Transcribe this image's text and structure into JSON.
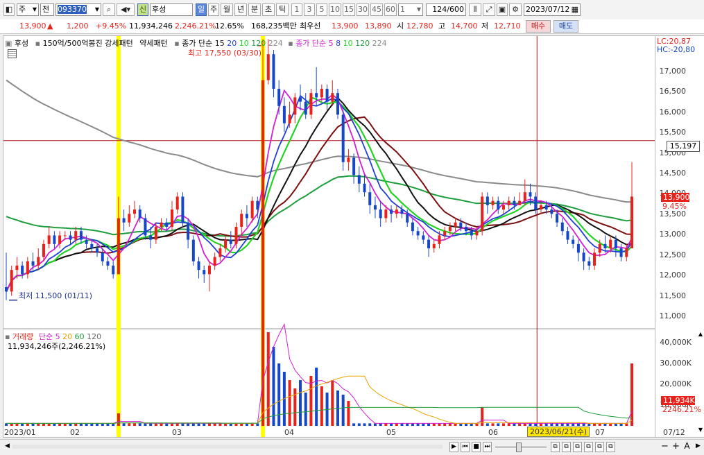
{
  "toolbar": {
    "market": "주",
    "view": "전",
    "code": "093370",
    "new_badge": "신",
    "stock_name": "후성",
    "periods": [
      "일",
      "주",
      "월",
      "년",
      "분",
      "초",
      "틱"
    ],
    "active_period": "일",
    "minutes": [
      "1",
      "3",
      "5",
      "10",
      "15",
      "30",
      "45",
      "60"
    ],
    "custom_minute": "1",
    "count": "124",
    "count_total": "/600",
    "date": "2023/07/12"
  },
  "quote": {
    "price": "13,900",
    "change_arrow": "▲",
    "change": "1,200",
    "change_pct": "+9.45%",
    "volume": "11,934,246",
    "volume_ratio": "2,246.21%",
    "turnover": "12.65%",
    "amount": "168,235백만",
    "best_label": "최우선",
    "best_ask": "13,900",
    "best_bid": "13,890",
    "open_label": "시",
    "open": "12,780",
    "high_label": "고",
    "high": "14,700",
    "low_label": "저",
    "low": "12,710",
    "buy": "매수",
    "sell": "매도"
  },
  "price_legend": {
    "name": "후성",
    "pattern": "150억/500억봉진 강세패턴",
    "weak": "약세패턴",
    "close_ma_label": "종가 단순",
    "ma_set1": [
      "15",
      "20",
      "10",
      "120",
      "224"
    ],
    "close_ma_label2": "종가 단순",
    "ma_set2": [
      "5",
      "8",
      "10",
      "120",
      "224"
    ],
    "high_note": "최고 17,550 (03/30)",
    "low_note": "최저 11,500 (01/11)"
  },
  "limits": {
    "lc": "LC:20,87",
    "hc": "HC:-20,80"
  },
  "price_axis": [
    "17,000",
    "16,500",
    "16,000",
    "15,500",
    "15,000",
    "14,500",
    "14,000",
    "13,500",
    "13,000",
    "12,500",
    "12,000",
    "11,500",
    "11,000"
  ],
  "cursor_price": "15,197",
  "last_price_tag": "13,900",
  "last_pct_tag": "9.45%",
  "volume_legend": {
    "label": "거래량",
    "ma_label": "단순",
    "periods": [
      "5",
      "20",
      "60",
      "120"
    ],
    "value": "11,934,246주(2,246.21%)"
  },
  "volume_axis": [
    "40,000K",
    "30,000K",
    "20,000K",
    "10,000K"
  ],
  "volume_tag": "11,934K",
  "volume_pct_tag": "2246.21%",
  "x_axis": [
    "2023/01",
    "02",
    "03",
    "04",
    "05",
    "06",
    "07"
  ],
  "cursor_date": "2023/06/21(수)",
  "end_date": "07/12",
  "colors": {
    "up": "#e8221b",
    "down": "#1747c9",
    "ma5": "#d21fd2",
    "ma10": "#22d422",
    "ma20": "#1f3fd6",
    "ma15": "#111111",
    "ma60": "#7a1010",
    "ma120": "#1e9e3c",
    "ma224": "#8a8a8a",
    "highlight": "#ffff00"
  },
  "chart_data": {
    "type": "candlestick",
    "x": [
      "2023/01",
      "02",
      "03",
      "04",
      "05",
      "06",
      "07"
    ],
    "ylim": [
      10900,
      17300
    ],
    "candles": [
      [
        0,
        11800,
        11700,
        12600,
        11500
      ],
      [
        1,
        11700,
        12200,
        12300,
        11600
      ],
      [
        2,
        12200,
        12300,
        12500,
        12000
      ],
      [
        3,
        12300,
        12100,
        12400,
        12000
      ],
      [
        4,
        12100,
        12400,
        12500,
        12000
      ],
      [
        5,
        12400,
        12300,
        12600,
        12200
      ],
      [
        6,
        12300,
        12500,
        12700,
        12200
      ],
      [
        7,
        12500,
        12800,
        12900,
        12400
      ],
      [
        8,
        12800,
        13000,
        13200,
        12700
      ],
      [
        9,
        13000,
        12800,
        13100,
        12700
      ],
      [
        10,
        12800,
        13000,
        13100,
        12700
      ],
      [
        11,
        13000,
        13000,
        13100,
        12900
      ],
      [
        12,
        13000,
        12900,
        13100,
        12800
      ],
      [
        13,
        12900,
        13100,
        13200,
        12800
      ],
      [
        14,
        13100,
        12900,
        13200,
        12800
      ],
      [
        15,
        12900,
        12800,
        13000,
        12700
      ],
      [
        16,
        12800,
        12700,
        12900,
        12600
      ],
      [
        17,
        12700,
        12600,
        12800,
        12500
      ],
      [
        18,
        12600,
        12400,
        12700,
        12300
      ],
      [
        19,
        12400,
        12300,
        12500,
        12200
      ],
      [
        20,
        12300,
        12100,
        12400,
        12000
      ],
      [
        21,
        12100,
        13400,
        13900,
        12100
      ],
      [
        22,
        13400,
        13300,
        13600,
        13100
      ],
      [
        23,
        13300,
        13500,
        13700,
        13200
      ],
      [
        24,
        13500,
        13600,
        13800,
        13400
      ],
      [
        25,
        13600,
        13400,
        13700,
        13300
      ],
      [
        26,
        13400,
        13000,
        13500,
        12900
      ],
      [
        27,
        13000,
        12900,
        13200,
        12700
      ],
      [
        28,
        12900,
        13200,
        13300,
        12800
      ],
      [
        29,
        13200,
        13300,
        13400,
        13100
      ],
      [
        30,
        13300,
        13200,
        13400,
        13100
      ],
      [
        31,
        13200,
        13600,
        13800,
        13100
      ],
      [
        32,
        13600,
        13900,
        14000,
        13500
      ],
      [
        33,
        13900,
        13300,
        14000,
        13200
      ],
      [
        34,
        13300,
        12900,
        13400,
        12700
      ],
      [
        35,
        12900,
        12400,
        13000,
        12300
      ],
      [
        36,
        12400,
        12200,
        12500,
        12000
      ],
      [
        37,
        12200,
        12100,
        12300,
        11900
      ],
      [
        38,
        12100,
        12300,
        12400,
        11700
      ],
      [
        39,
        12300,
        12500,
        12600,
        12200
      ],
      [
        40,
        12500,
        12700,
        12800,
        12400
      ],
      [
        41,
        12700,
        12900,
        13000,
        12600
      ],
      [
        42,
        12900,
        12800,
        13100,
        12700
      ],
      [
        43,
        12800,
        13200,
        13300,
        12700
      ],
      [
        44,
        13200,
        13500,
        13600,
        13000
      ],
      [
        45,
        13500,
        13400,
        13700,
        13200
      ],
      [
        46,
        13400,
        13800,
        13900,
        13300
      ],
      [
        47,
        13800,
        13600,
        13900,
        13400
      ],
      [
        48,
        13600,
        16600,
        17550,
        13500
      ],
      [
        49,
        16600,
        17200,
        17550,
        16500
      ],
      [
        50,
        17200,
        16400,
        17300,
        16200
      ],
      [
        51,
        16400,
        16000,
        16600,
        15800
      ],
      [
        52,
        16000,
        15600,
        16200,
        15400
      ],
      [
        53,
        15600,
        15800,
        16100,
        15500
      ],
      [
        54,
        15800,
        16200,
        16300,
        15600
      ],
      [
        55,
        16200,
        16100,
        16500,
        15900
      ],
      [
        56,
        16100,
        15800,
        16300,
        15700
      ],
      [
        57,
        15800,
        16300,
        16400,
        15700
      ],
      [
        58,
        16300,
        16200,
        16900,
        16000
      ],
      [
        59,
        16200,
        16400,
        16500,
        16100
      ],
      [
        60,
        16400,
        16100,
        16500,
        15900
      ],
      [
        61,
        16100,
        16300,
        16600,
        16000
      ],
      [
        62,
        16300,
        15800,
        16400,
        15700
      ],
      [
        63,
        15800,
        14700,
        15900,
        14500
      ],
      [
        64,
        14700,
        14800,
        15000,
        14500
      ],
      [
        65,
        14800,
        14400,
        14900,
        14200
      ],
      [
        66,
        14400,
        14200,
        14600,
        14000
      ],
      [
        67,
        14200,
        14000,
        14400,
        13900
      ],
      [
        68,
        14000,
        13700,
        14200,
        13500
      ],
      [
        69,
        13700,
        13600,
        13900,
        13400
      ],
      [
        70,
        13600,
        13400,
        13800,
        13200
      ],
      [
        71,
        13400,
        13600,
        13700,
        13300
      ],
      [
        72,
        13600,
        13500,
        13700,
        13300
      ],
      [
        73,
        13500,
        13600,
        13700,
        13400
      ],
      [
        74,
        13600,
        13500,
        13700,
        13400
      ],
      [
        75,
        13500,
        13300,
        13600,
        13200
      ],
      [
        76,
        13300,
        13100,
        13400,
        13000
      ],
      [
        77,
        13100,
        13000,
        13200,
        12900
      ],
      [
        78,
        13000,
        12900,
        13100,
        12800
      ],
      [
        79,
        12900,
        12700,
        13000,
        12500
      ],
      [
        80,
        12700,
        12800,
        12900,
        12600
      ],
      [
        81,
        12800,
        13000,
        13100,
        12700
      ],
      [
        82,
        13000,
        13100,
        13200,
        12900
      ],
      [
        83,
        13100,
        13200,
        13300,
        13000
      ],
      [
        84,
        13200,
        13300,
        13400,
        13100
      ],
      [
        85,
        13300,
        13200,
        13400,
        13100
      ],
      [
        86,
        13200,
        13100,
        13300,
        13000
      ],
      [
        87,
        13100,
        13000,
        13200,
        12900
      ],
      [
        88,
        13000,
        13100,
        13200,
        12900
      ],
      [
        89,
        13100,
        13900,
        14000,
        13000
      ],
      [
        90,
        13900,
        13700,
        14000,
        13500
      ],
      [
        91,
        13700,
        13800,
        13900,
        13600
      ],
      [
        92,
        13800,
        13600,
        13900,
        13500
      ],
      [
        93,
        13600,
        13700,
        13800,
        13500
      ],
      [
        94,
        13700,
        13800,
        13900,
        13600
      ],
      [
        95,
        13800,
        13700,
        13900,
        13600
      ],
      [
        96,
        13700,
        13800,
        14000,
        13700
      ],
      [
        97,
        13800,
        14000,
        14300,
        13700
      ],
      [
        98,
        14000,
        13900,
        14200,
        13700
      ],
      [
        99,
        13900,
        13600,
        14000,
        13500
      ],
      [
        100,
        13600,
        13700,
        13800,
        13500
      ],
      [
        101,
        13700,
        13600,
        13800,
        13500
      ],
      [
        102,
        13600,
        13500,
        13700,
        13400
      ],
      [
        103,
        13500,
        13300,
        13600,
        13200
      ],
      [
        104,
        13300,
        13100,
        13400,
        13000
      ],
      [
        105,
        13100,
        12900,
        13200,
        12800
      ],
      [
        106,
        12900,
        12800,
        13000,
        12700
      ],
      [
        107,
        12800,
        12600,
        12900,
        12400
      ],
      [
        108,
        12600,
        12400,
        12700,
        12200
      ],
      [
        109,
        12400,
        12300,
        12500,
        12200
      ],
      [
        110,
        12300,
        12600,
        12700,
        12200
      ],
      [
        111,
        12600,
        12800,
        12900,
        12500
      ],
      [
        112,
        12800,
        12700,
        13000,
        12600
      ],
      [
        113,
        12700,
        12900,
        13000,
        12600
      ],
      [
        114,
        12900,
        12700,
        13000,
        12500
      ],
      [
        115,
        12700,
        12500,
        12800,
        12400
      ],
      [
        116,
        12500,
        12700,
        12800,
        12400
      ],
      [
        117,
        12700,
        13900,
        14700,
        12710
      ]
    ],
    "volume": [
      [
        21,
        0.6
      ],
      [
        48,
        10.5
      ],
      [
        49,
        4.5
      ],
      [
        50,
        3.8
      ],
      [
        51,
        3.0
      ],
      [
        52,
        2.6
      ],
      [
        53,
        2.2
      ],
      [
        54,
        1.8
      ],
      [
        55,
        2.2
      ],
      [
        56,
        1.6
      ],
      [
        57,
        2.4
      ],
      [
        58,
        2.8
      ],
      [
        59,
        1.9
      ],
      [
        60,
        1.6
      ],
      [
        61,
        2.2
      ],
      [
        62,
        1.7
      ],
      [
        63,
        1.5
      ],
      [
        64,
        1.2
      ],
      [
        89,
        0.9
      ],
      [
        117,
        3.0
      ]
    ]
  }
}
